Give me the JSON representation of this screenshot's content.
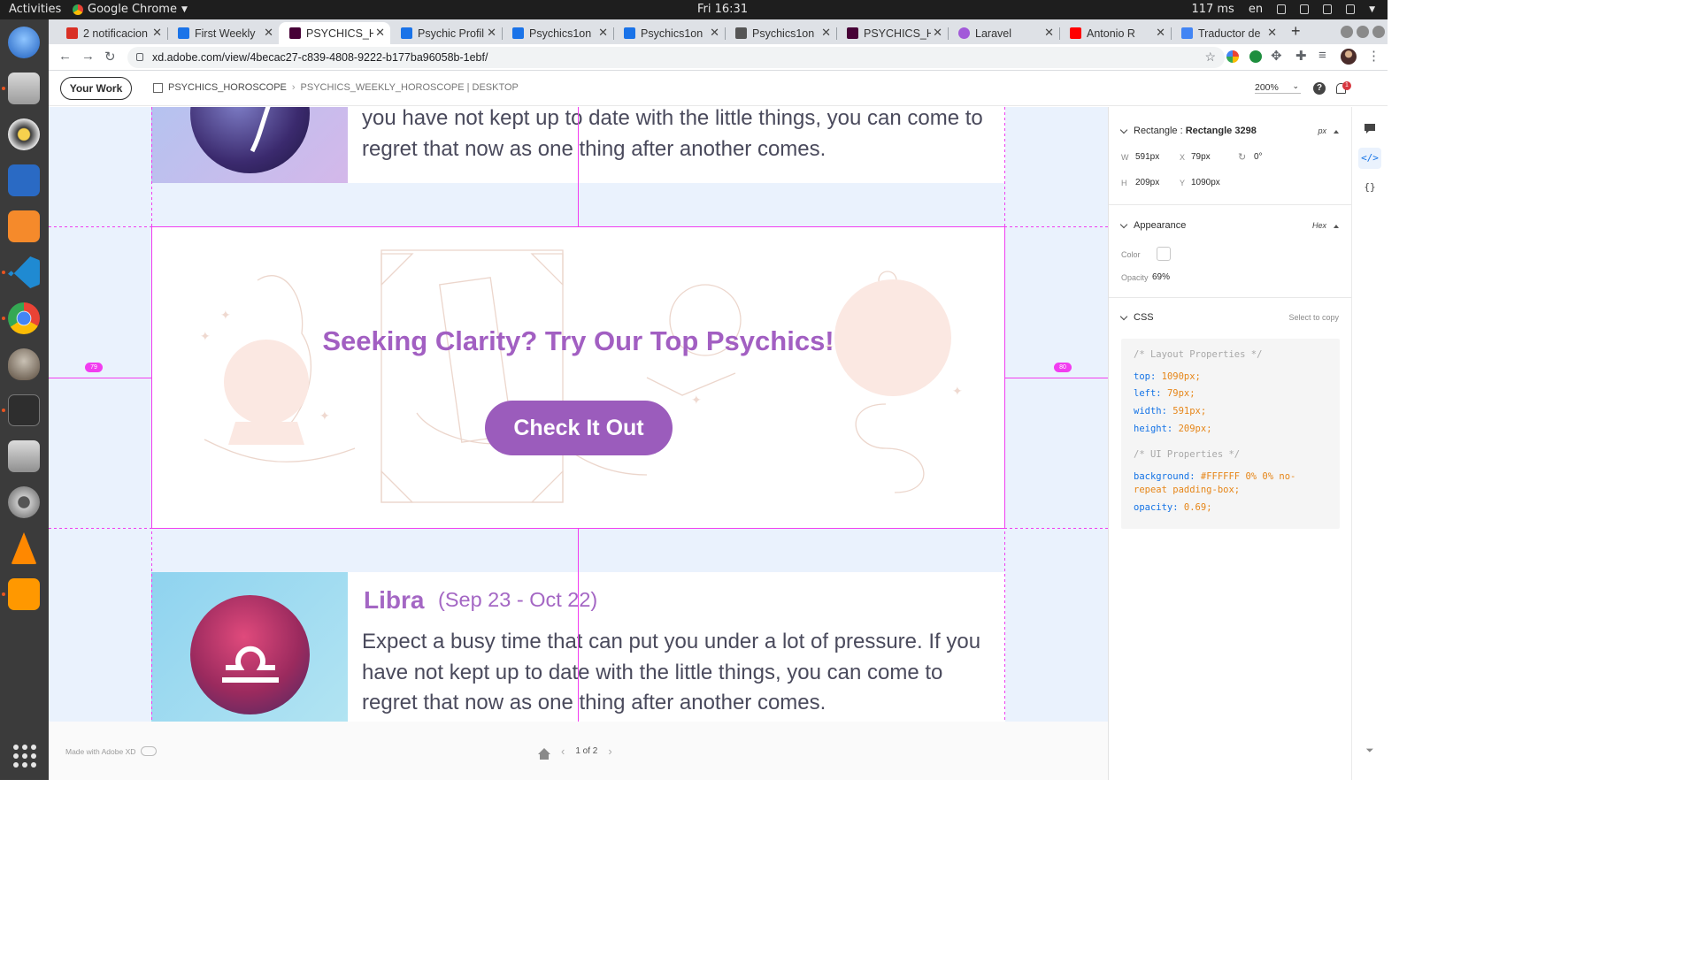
{
  "system": {
    "activities": "Activities",
    "app_name": "Google Chrome",
    "clock": "Fri 16:31",
    "latency": "117 ms",
    "language": "en"
  },
  "browser": {
    "tabs": [
      {
        "title": "2 notificacion",
        "favicon_color": "#d93025"
      },
      {
        "title": "First Weekly",
        "favicon_color": "#1a73e8"
      },
      {
        "title": "PSYCHICS_HO",
        "favicon_color": "#470137",
        "active": true
      },
      {
        "title": "Psychic Profil",
        "favicon_color": "#1a73e8"
      },
      {
        "title": "Psychics1on",
        "favicon_color": "#1a73e8"
      },
      {
        "title": "Psychics1on",
        "favicon_color": "#1a73e8"
      },
      {
        "title": "Psychics1on",
        "favicon_color": "#555555"
      },
      {
        "title": "PSYCHICS_HO",
        "favicon_color": "#470137"
      },
      {
        "title": "Laravel",
        "favicon_color": "#a259d9"
      },
      {
        "title": "Antonio R",
        "favicon_color": "#ff0000"
      },
      {
        "title": "Traductor de",
        "favicon_color": "#4285f4"
      }
    ],
    "url": "xd.adobe.com/view/4becac27-c839-4808-9222-b177ba96058b-1ebf/"
  },
  "xd_header": {
    "your_work": "Your Work",
    "project": "PSYCHICS_HOROSCOPE",
    "screen": "PSYCHICS_WEEKLY_HOROSCOPE | DESKTOP",
    "zoom": "200%",
    "help": "?",
    "notifications_count": "1"
  },
  "canvas": {
    "top_card_text": "you have not kept up to date with the little things, you can come to regret that now as one thing after another comes.",
    "banner_title": "Seeking Clarity? Try Our Top Psychics!",
    "cta_label": "Check It Out",
    "sign": {
      "name": "Libra",
      "dates": "(Sep 23 - Oct 22)",
      "text": "Expect a busy time that can put you under a lot of pressure. If you have not kept up to date with the little things, you can come to regret that now as one thing after another comes."
    },
    "guide_left_label": "79",
    "guide_right_label": "80",
    "colors": {
      "canvas_bg": "#eaf2fd",
      "accent": "#a25fc2",
      "button": "#9b5cbc",
      "guide": "#f13df0"
    }
  },
  "footer": {
    "made_with": "Made with Adobe XD",
    "pager": "1 of 2"
  },
  "inspect": {
    "layer_type": "Rectangle",
    "layer_name": "Rectangle 3298",
    "unit": "px",
    "w_label": "W",
    "w_value": "591px",
    "x_label": "X",
    "x_value": "79px",
    "rotation": "0°",
    "h_label": "H",
    "h_value": "209px",
    "y_label": "Y",
    "y_value": "1090px",
    "appearance_title": "Appearance",
    "color_mode": "Hex",
    "color_label": "Color",
    "opacity_label": "Opacity",
    "opacity_value": "69%",
    "css_title": "CSS",
    "select_to_copy": "Select to copy",
    "css_lines": {
      "comment_layout": "/* Layout Properties */",
      "top_prop": "top:",
      "top_val": "1090px;",
      "left_prop": "left:",
      "left_val": "79px;",
      "width_prop": "width:",
      "width_val": "591px;",
      "height_prop": "height:",
      "height_val": "209px;",
      "comment_ui": "/* UI Properties */",
      "bg_prop": "background:",
      "bg_val_1": "#FFFFFF 0% 0% no-",
      "bg_val_2": "repeat padding-box;",
      "opacity_prop": "opacity:",
      "opacity_val": "0.69;"
    }
  },
  "rail": {
    "comment_icon": "comment-icon",
    "code_btn": "</>",
    "json_btn": "{}"
  }
}
